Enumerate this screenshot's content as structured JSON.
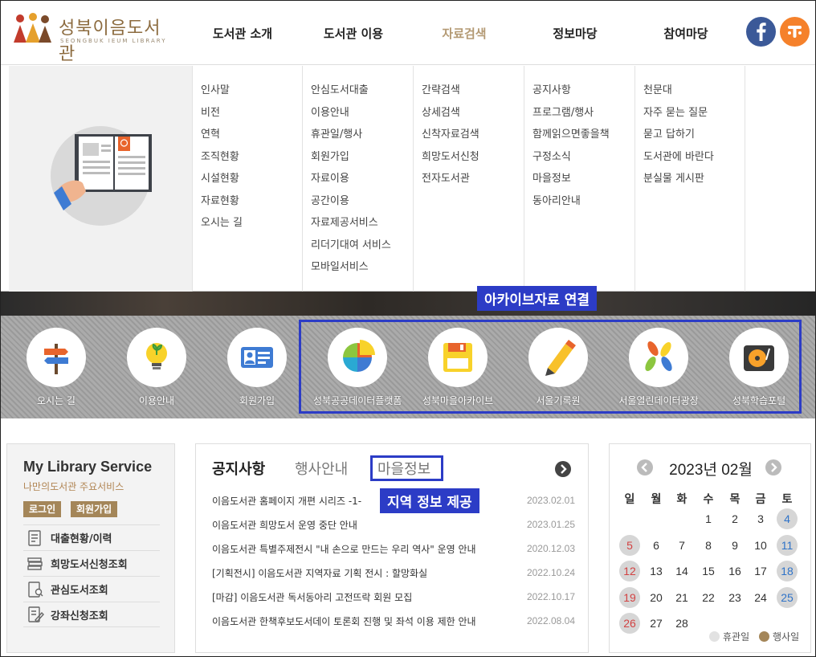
{
  "header": {
    "logo_text": "성북이음도서관",
    "logo_sub": "SEONGBUK IEUM LIBRARY",
    "nav": [
      "도서관 소개",
      "도서관 이용",
      "자료검색",
      "정보마당",
      "참여마당"
    ],
    "active_nav": "자료검색",
    "colors": {
      "accent": "#b49a74",
      "facebook": "#3b5998",
      "orange": "#f5812b"
    }
  },
  "dropdown": {
    "columns": [
      [
        "인사말",
        "비전",
        "연혁",
        "조직현황",
        "시설현황",
        "자료현황",
        "오시는 길"
      ],
      [
        "안심도서대출",
        "이용안내",
        "휴관일/행사",
        "회원가입",
        "자료이용",
        "공간이용",
        "자료제공서비스",
        "리더기대여 서비스",
        "모바일서비스"
      ],
      [
        "간략검색",
        "상세검색",
        "신착자료검색",
        "희망도서신청",
        "전자도서관"
      ],
      [
        "공지사항",
        "프로그램/행사",
        "함께읽으면좋을책",
        "구정소식",
        "마을정보",
        "동아리안내"
      ],
      [
        "천문대",
        "자주 묻는 질문",
        "묻고 답하기",
        "도서관에 바란다",
        "분실물 게시판"
      ]
    ]
  },
  "quick_links": [
    "오시는 길",
    "이용안내",
    "회원가입"
  ],
  "archive": {
    "tag": "아카이브자료 연결",
    "links": [
      "성북공공데이터플랫폼",
      "성북마을아카이브",
      "서울기록원",
      "서울열린데이터광장",
      "성북학습포털"
    ]
  },
  "my_library": {
    "title": "My Library Service",
    "subtitle": "나만의도서관 주요서비스",
    "login": "로그인",
    "join": "회원가입",
    "items": [
      "대출현황/이력",
      "희망도서신청조회",
      "관심도서조회",
      "강좌신청조회"
    ]
  },
  "notice": {
    "tabs": [
      "공지사항",
      "행사안내",
      "마을정보"
    ],
    "region_tag": "지역 정보 제공",
    "rows": [
      {
        "title": "이음도서관 홈페이지 개편 시리즈 -1-",
        "date": "2023.02.01"
      },
      {
        "title": "이음도서관 희망도서 운영 중단 안내",
        "date": "2023.01.25"
      },
      {
        "title": "이음도서관 특별주제전시 \"내 손으로 만드는 우리 역사\" 운영 안내",
        "date": "2020.12.03"
      },
      {
        "title": "[기획전시] 이음도서관 지역자료 기획 전시 : 할망화실",
        "date": "2022.10.24"
      },
      {
        "title": "[마감] 이음도서관 독서동아리 고전뜨락 회원 모집",
        "date": "2022.10.17"
      },
      {
        "title": "이음도서관 한책후보도서데이 토론회 진행 및 좌석 이용 제한 안내",
        "date": "2022.08.04"
      }
    ]
  },
  "calendar": {
    "title": "2023년 02월",
    "weekdays": [
      "일",
      "월",
      "화",
      "수",
      "목",
      "금",
      "토"
    ],
    "weeks": [
      [
        "",
        "",
        "",
        "1",
        "2",
        "3",
        "4"
      ],
      [
        "5",
        "6",
        "7",
        "8",
        "9",
        "10",
        "11"
      ],
      [
        "12",
        "13",
        "14",
        "15",
        "16",
        "17",
        "18"
      ],
      [
        "19",
        "20",
        "21",
        "22",
        "23",
        "24",
        "25"
      ],
      [
        "26",
        "27",
        "28",
        "",
        "",
        "",
        ""
      ]
    ],
    "legend_closed": "휴관일",
    "legend_event": "행사일",
    "colors": {
      "sunday": "#d24242",
      "saturday": "#2f73c8",
      "closed": "#d6d6d6",
      "event": "#a48659"
    }
  }
}
